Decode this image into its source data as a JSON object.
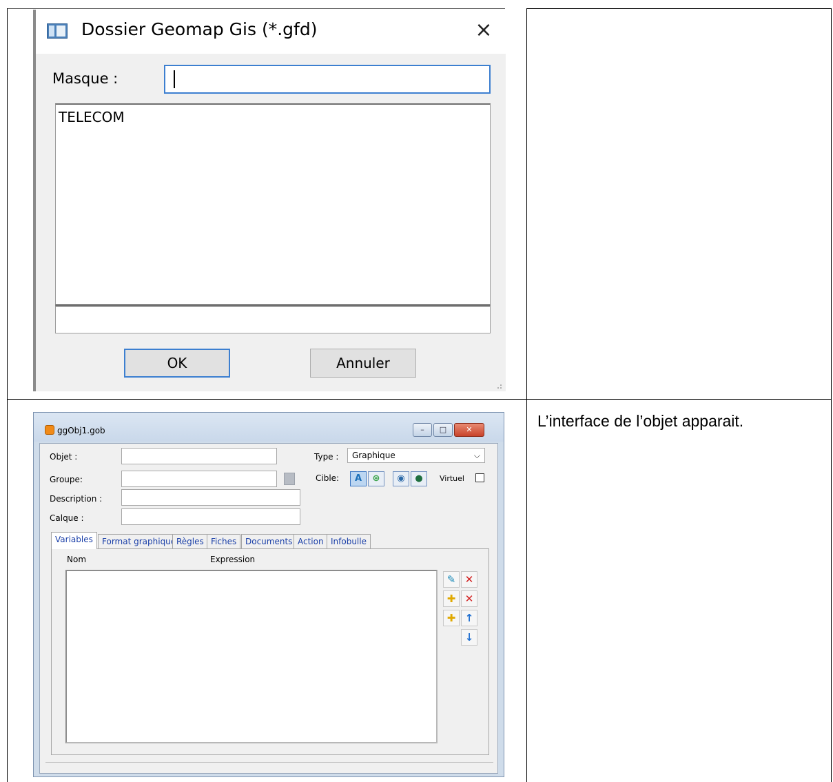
{
  "dialog_folder": {
    "title": "Dossier Geomap Gis (*.gfd)",
    "close_glyph": "×",
    "mask_label": "Masque :",
    "mask_value": "",
    "list_items": [
      "TELECOM"
    ],
    "ok_label": "OK",
    "cancel_label": "Annuler"
  },
  "caption": "L’interface de l’objet apparait.",
  "dialog_object": {
    "title": "ggObj1.gob",
    "window_controls": {
      "minimize": "–",
      "maximize": "□",
      "close": "✕"
    },
    "labels": {
      "objet": "Objet :",
      "groupe": "Groupe:",
      "description": "Description :",
      "calque": "Calque :",
      "type": "Type :",
      "cible": "Cible:",
      "virtuel": "Virtuel"
    },
    "type_value": "Graphique",
    "cible_icons": [
      "autocad-icon",
      "geo-icon",
      "globe-icon",
      "earth-icon"
    ],
    "tabs": [
      "Variables",
      "Format graphique",
      "Règles",
      "Fiches",
      "Documents",
      "Action",
      "Infobulle"
    ],
    "active_tab": "Variables",
    "columns": [
      "Nom",
      "Expression"
    ],
    "tool_icons": [
      "edit-icon",
      "delete-icon",
      "add-icon",
      "delete-all-icon",
      "add-multiple-icon",
      "move-up-icon",
      "move-down-icon"
    ],
    "colors": {
      "accent": "#3c7fd0",
      "tab_text": "#1a3fa8",
      "close_red": "#c8432b"
    }
  }
}
